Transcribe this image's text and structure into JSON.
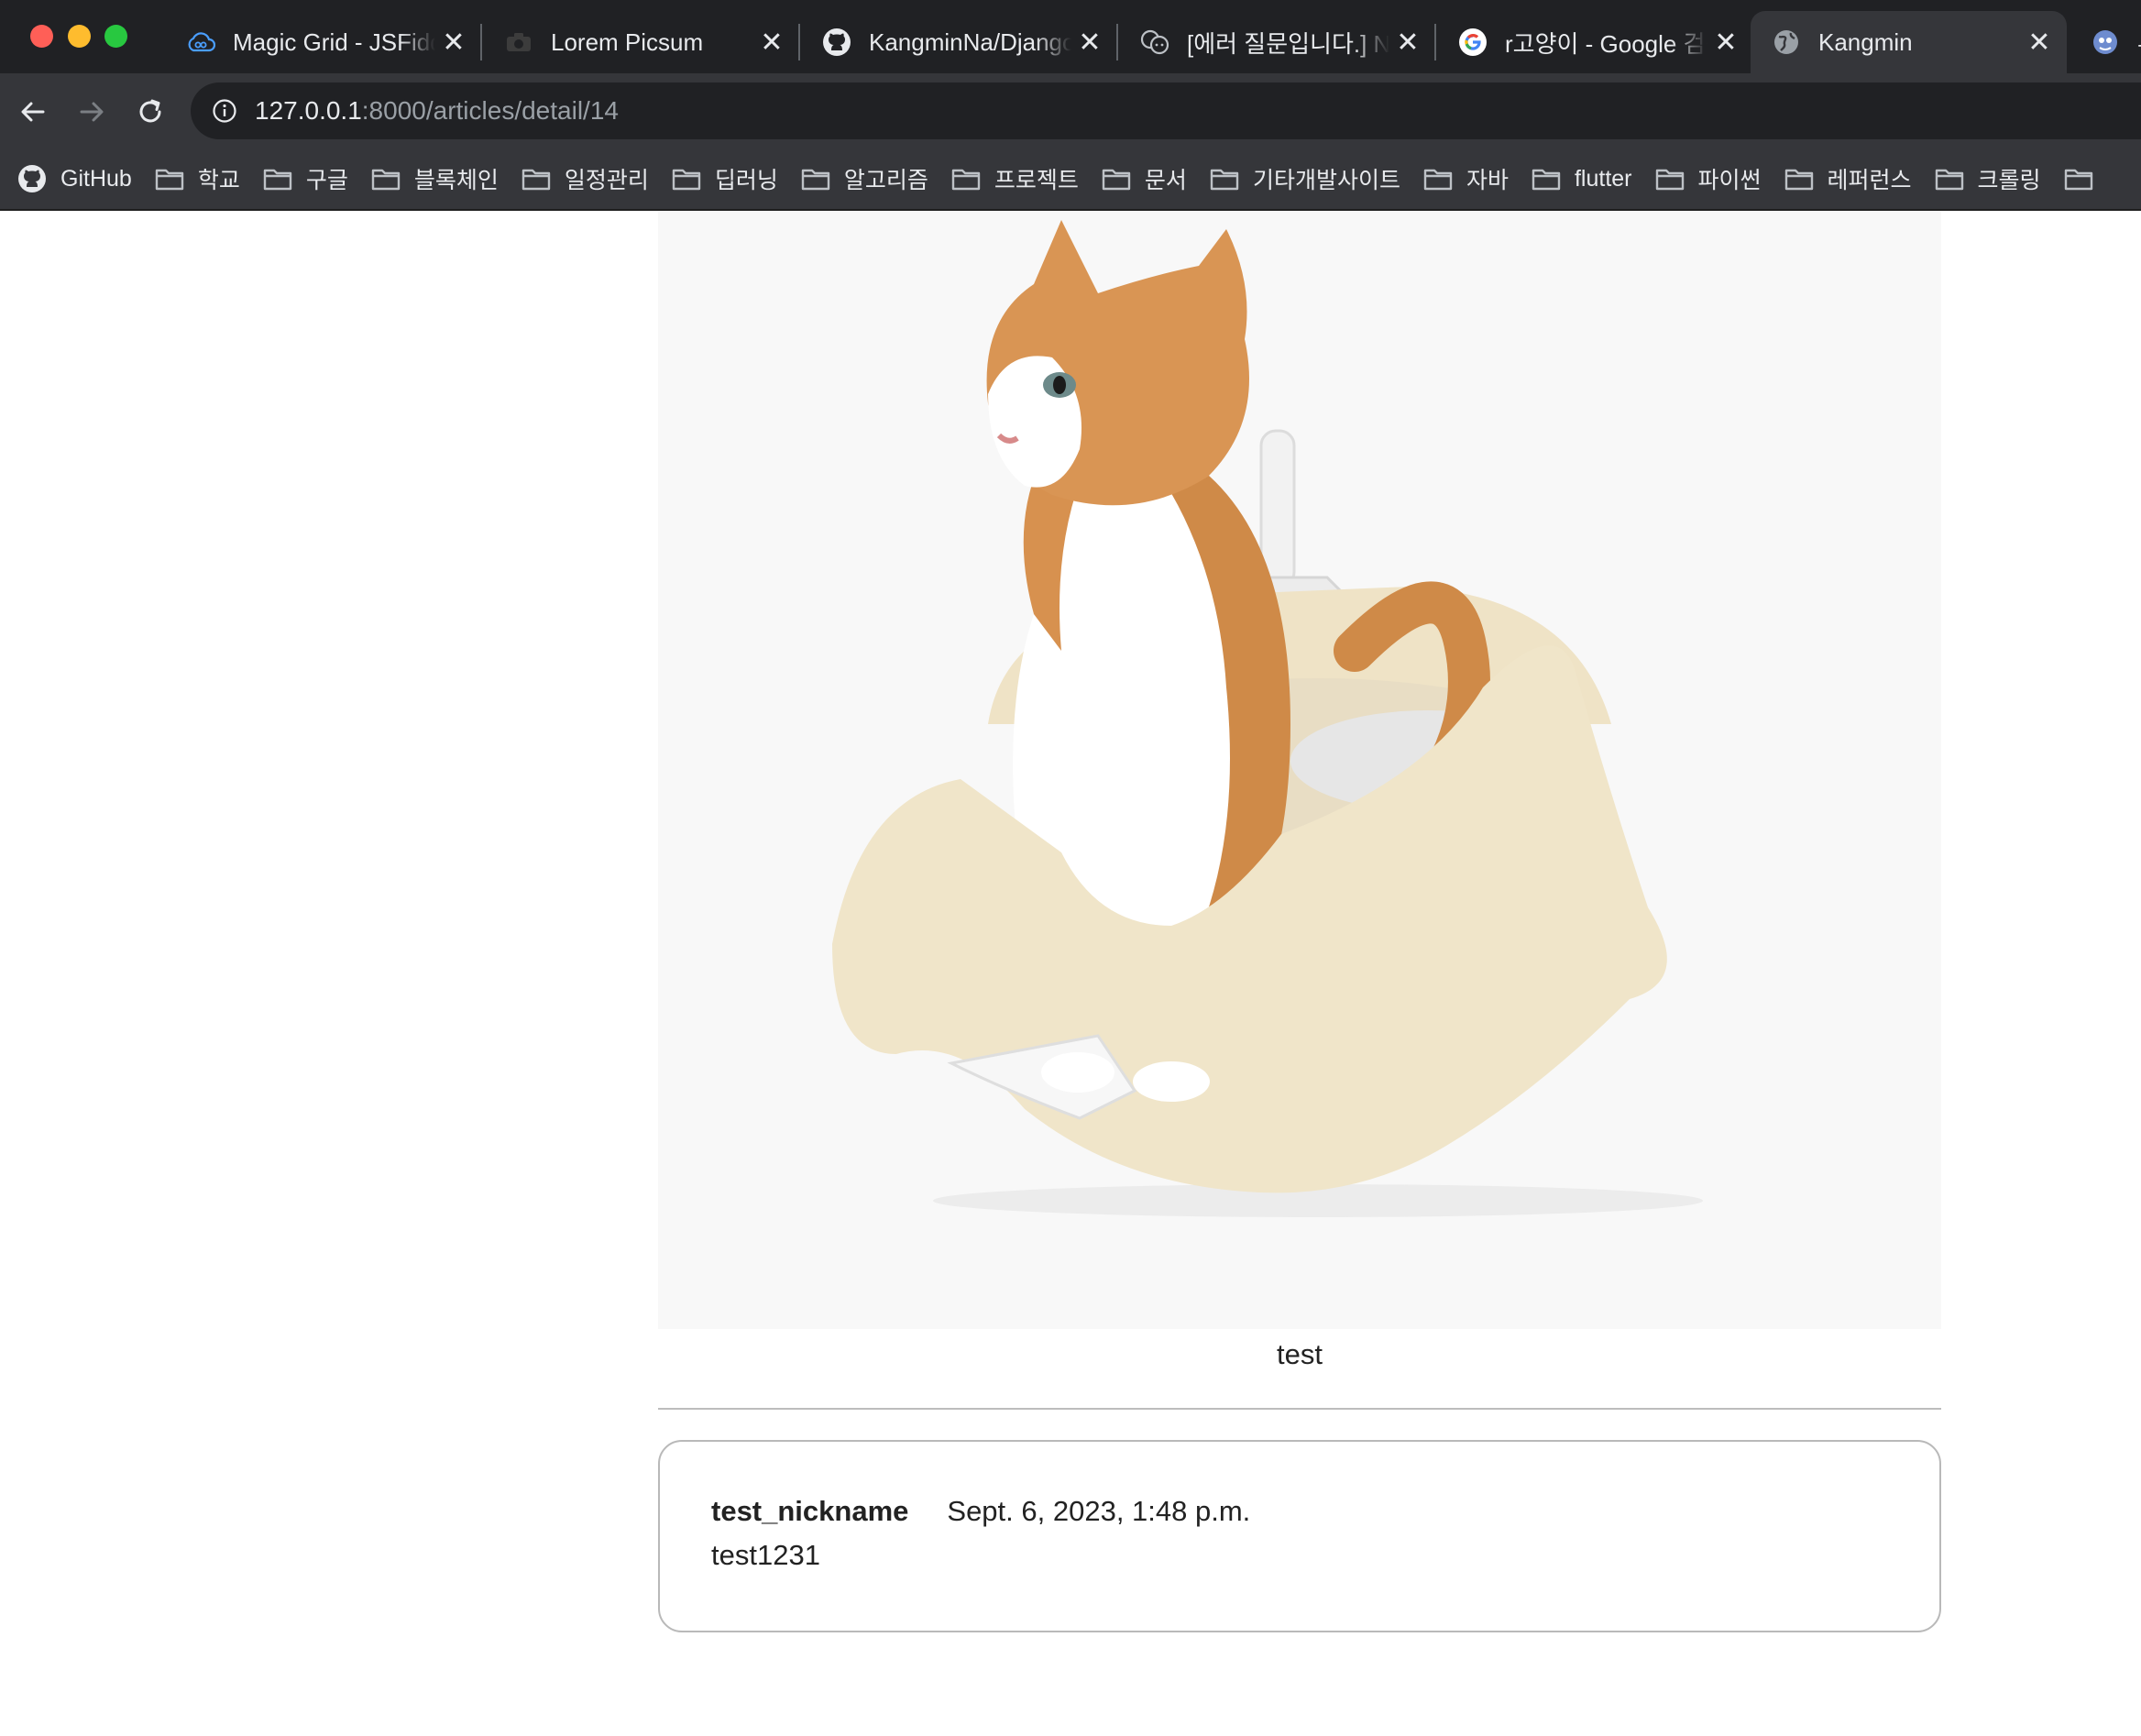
{
  "browser": {
    "tabs": [
      {
        "title": "Magic Grid - JSFiddle",
        "icon": "jsfiddle-cloud-icon"
      },
      {
        "title": "Lorem Picsum",
        "icon": "picsum-camera-icon"
      },
      {
        "title": "KangminNa/Django",
        "icon": "github-icon"
      },
      {
        "title": "[에러 질문입니다.] No",
        "icon": "chat-bubbles-icon"
      },
      {
        "title": "r고양이 - Google 검색",
        "icon": "google-icon"
      },
      {
        "title": "Kangmin",
        "icon": "globe-icon",
        "active": true
      },
      {
        "title": "무",
        "icon": "globe-alien-icon"
      }
    ],
    "close_glyph": "✕",
    "url_host": "127.0.0.1",
    "url_path": ":8000/articles/detail/14",
    "bookmarks": [
      {
        "label": "GitHub",
        "icon": "github-icon"
      },
      {
        "label": "학교",
        "icon": "folder-icon"
      },
      {
        "label": "구글",
        "icon": "folder-icon"
      },
      {
        "label": "블록체인",
        "icon": "folder-icon"
      },
      {
        "label": "일정관리",
        "icon": "folder-icon"
      },
      {
        "label": "딥러닝",
        "icon": "folder-icon"
      },
      {
        "label": "알고리즘",
        "icon": "folder-icon"
      },
      {
        "label": "프로젝트",
        "icon": "folder-icon"
      },
      {
        "label": "문서",
        "icon": "folder-icon"
      },
      {
        "label": "기타개발사이트",
        "icon": "folder-icon"
      },
      {
        "label": "자바",
        "icon": "folder-icon"
      },
      {
        "label": "flutter",
        "icon": "folder-icon"
      },
      {
        "label": "파이썬",
        "icon": "folder-icon"
      },
      {
        "label": "레퍼런스",
        "icon": "folder-icon"
      },
      {
        "label": "크롤링",
        "icon": "folder-icon"
      },
      {
        "label": "",
        "icon": "folder-icon"
      }
    ]
  },
  "article": {
    "image_subject": "orange-and-white cat sitting in a cream litter box",
    "content": "test"
  },
  "comment": {
    "author": "test_nickname",
    "date": "Sept. 6, 2023, 1:48 p.m.",
    "body": "test1231"
  },
  "colors": {
    "chrome_dark": "#202124",
    "chrome_toolbar": "#35363a",
    "card_border": "#b9b9b9",
    "image_bg": "#f8f8f8"
  }
}
